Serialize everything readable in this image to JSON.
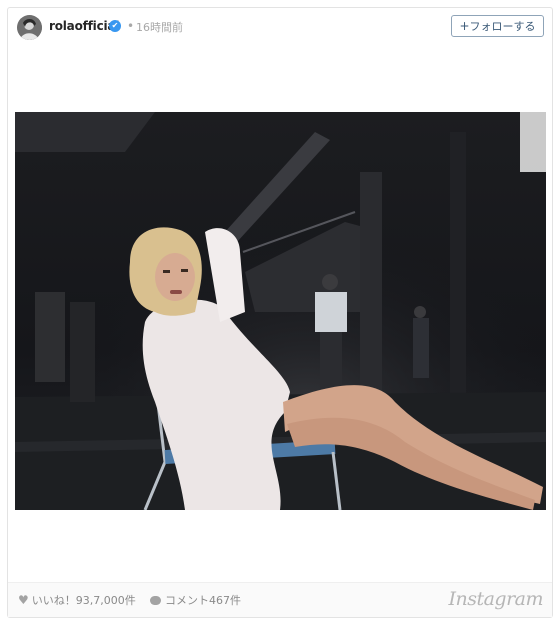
{
  "post": {
    "username": "rolaofficial",
    "verified_mark": "✔",
    "separator": "•",
    "time_ago": "16時間前",
    "follow_label": "フォローする",
    "follow_plus": "+",
    "image_icon": "photo-image"
  },
  "footer": {
    "likes_label": "いいね！93,7,000件",
    "comments_label": "コメント467件",
    "brand": "Instagram"
  },
  "colors": {
    "verified": "#3897f0",
    "follow_border": "#8fa4b8",
    "follow_text": "#3b5a78"
  }
}
